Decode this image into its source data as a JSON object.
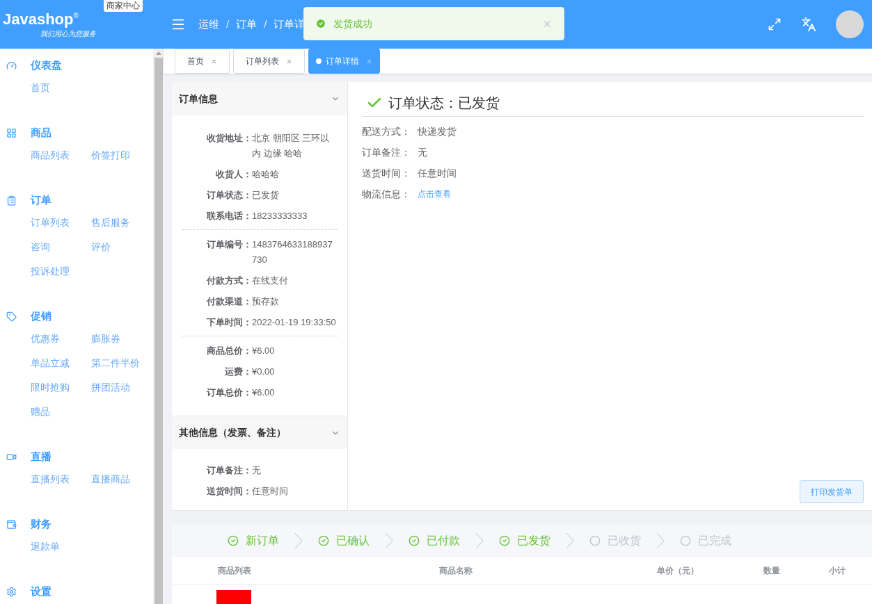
{
  "header": {
    "logo": "Javashop",
    "logo_mark": "®",
    "logo_slogan": "我们用心为您服务",
    "badge": "商家中心",
    "breadcrumb": [
      "运维",
      "订单",
      "订单详"
    ],
    "breadcrumb_separator": "/"
  },
  "toast": {
    "message": "发货成功"
  },
  "sidebar": {
    "groups": [
      {
        "title": "仪表盘",
        "items": [
          "首页"
        ]
      },
      {
        "title": "商品",
        "items": [
          "商品列表",
          "价签打印"
        ]
      },
      {
        "title": "订单",
        "items": [
          "订单列表",
          "售后服务",
          "咨询",
          "评价",
          "投诉处理"
        ]
      },
      {
        "title": "促销",
        "items": [
          "优惠券",
          "膨胀券",
          "单品立减",
          "第二件半价",
          "限时抢购",
          "拼团活动",
          "赠品"
        ]
      },
      {
        "title": "直播",
        "items": [
          "直播列表",
          "直播商品"
        ]
      },
      {
        "title": "财务",
        "items": [
          "退款单"
        ]
      },
      {
        "title": "设置"
      }
    ]
  },
  "tabs": [
    {
      "label": "首页",
      "selected": false
    },
    {
      "label": "订单列表",
      "selected": false
    },
    {
      "label": "订单详情",
      "selected": true
    }
  ],
  "order_info": {
    "title": "订单信息",
    "sections": [
      [
        {
          "label": "收货地址：",
          "value": "北京 朝阳区 三环以内 边缘 哈哈"
        },
        {
          "label": "收货人：",
          "value": "哈哈哈"
        },
        {
          "label": "订单状态：",
          "value": "已发货"
        },
        {
          "label": "联系电话：",
          "value": "18233333333"
        }
      ],
      [
        {
          "label": "订单编号：",
          "value": "1483764633188937730"
        },
        {
          "label": "付款方式：",
          "value": "在线支付"
        },
        {
          "label": "付款渠道：",
          "value": "预存款"
        },
        {
          "label": "下单时间：",
          "value": "2022-01-19 19:33:50"
        }
      ],
      [
        {
          "label": "商品总价：",
          "value": "¥6.00"
        },
        {
          "label": "运费：",
          "value": "¥0.00"
        },
        {
          "label": "订单总价：",
          "value": "¥6.00"
        }
      ]
    ]
  },
  "other_info": {
    "title": "其他信息（发票、备注）",
    "rows": [
      {
        "label": "订单备注：",
        "value": "无"
      },
      {
        "label": "送货时间：",
        "value": "任意时间"
      }
    ]
  },
  "status": {
    "title": "订单状态：已发货",
    "rows": [
      {
        "label": "配送方式：",
        "value": "快递发货",
        "kind": "text"
      },
      {
        "label": "订单备注：",
        "value": "无",
        "kind": "text"
      },
      {
        "label": "送货时间：",
        "value": "任意时间",
        "kind": "text"
      },
      {
        "label": "物流信息：",
        "value": "点击查看",
        "kind": "link"
      }
    ],
    "button": "打印发货单"
  },
  "steps": [
    {
      "label": "新订单",
      "done": true
    },
    {
      "label": "已确认",
      "done": true
    },
    {
      "label": "已付款",
      "done": true
    },
    {
      "label": "已发货",
      "done": true
    },
    {
      "label": "已收货",
      "done": false
    },
    {
      "label": "已完成",
      "done": false
    }
  ],
  "table": {
    "columns": [
      "商品列表",
      "商品名称",
      "单价（元）",
      "数量",
      "小计"
    ]
  }
}
